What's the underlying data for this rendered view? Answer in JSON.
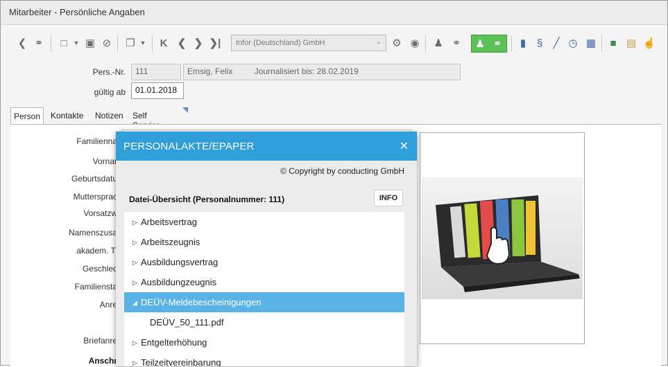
{
  "window": {
    "title": "Mitarbeiter - Persönliche Angaben"
  },
  "toolbar": {
    "company_select": "Infor (Deutschland) GmbH",
    "icons": [
      "back-icon",
      "link-icon",
      "document-icon",
      "save-icon",
      "delete-icon",
      "pages-icon",
      "first-icon",
      "prev-icon",
      "next-icon",
      "last-icon",
      "gears-icon",
      "globe-icon",
      "people-icon",
      "link-icon",
      "green-link-icon",
      "green-link-icon-2",
      "shield-icon",
      "paragraph-icon",
      "pen-icon",
      "clock-icon",
      "window-icon",
      "tree-icon",
      "scroll-icon",
      "hand-icon"
    ]
  },
  "header": {
    "pers_nr_label": "Pers.-Nr.",
    "pers_nr": "111",
    "name": "Emsig, Felix",
    "journal": "Journalisiert bis: 28.02.2019",
    "valid_label": "gültig ab",
    "valid_from": "01.01.2018"
  },
  "tabs": [
    "Person",
    "Kontakte",
    "Notizen",
    "Self Service"
  ],
  "form": {
    "labels": [
      "Familienna",
      "Vornar",
      "Geburtsdatu",
      "Muttersprac",
      "Vorsatzw",
      "Namenszusa",
      "akadem. Ti",
      "Geschlec",
      "Familiensta",
      "Anre",
      "Briefanre",
      "Anschr"
    ]
  },
  "modal": {
    "title": "PERSONALAKTE/EPAPER",
    "copyright": "© Copyright by conducting GmbH",
    "overview": "Datei-Übersicht (Personalnummer: 111)",
    "info_button": "INFO",
    "items": [
      {
        "label": "Arbeitsvertrag",
        "state": "collapsed"
      },
      {
        "label": "Arbeitszeugnis",
        "state": "collapsed"
      },
      {
        "label": "Ausbildungsvertrag",
        "state": "collapsed"
      },
      {
        "label": "Ausbildungzeugnis",
        "state": "collapsed"
      },
      {
        "label": "DEÜV-Meldebescheinigungen",
        "state": "expanded"
      },
      {
        "label": "DEÜV_50_111.pdf",
        "state": "file"
      },
      {
        "label": "Entgelterhöhung",
        "state": "collapsed"
      },
      {
        "label": "Teilzeitvereinbarung",
        "state": "collapsed"
      }
    ]
  },
  "colors": {
    "accent": "#2f9fd9",
    "selection": "#5ab3e6",
    "toolbar_green": "#5ec157"
  }
}
